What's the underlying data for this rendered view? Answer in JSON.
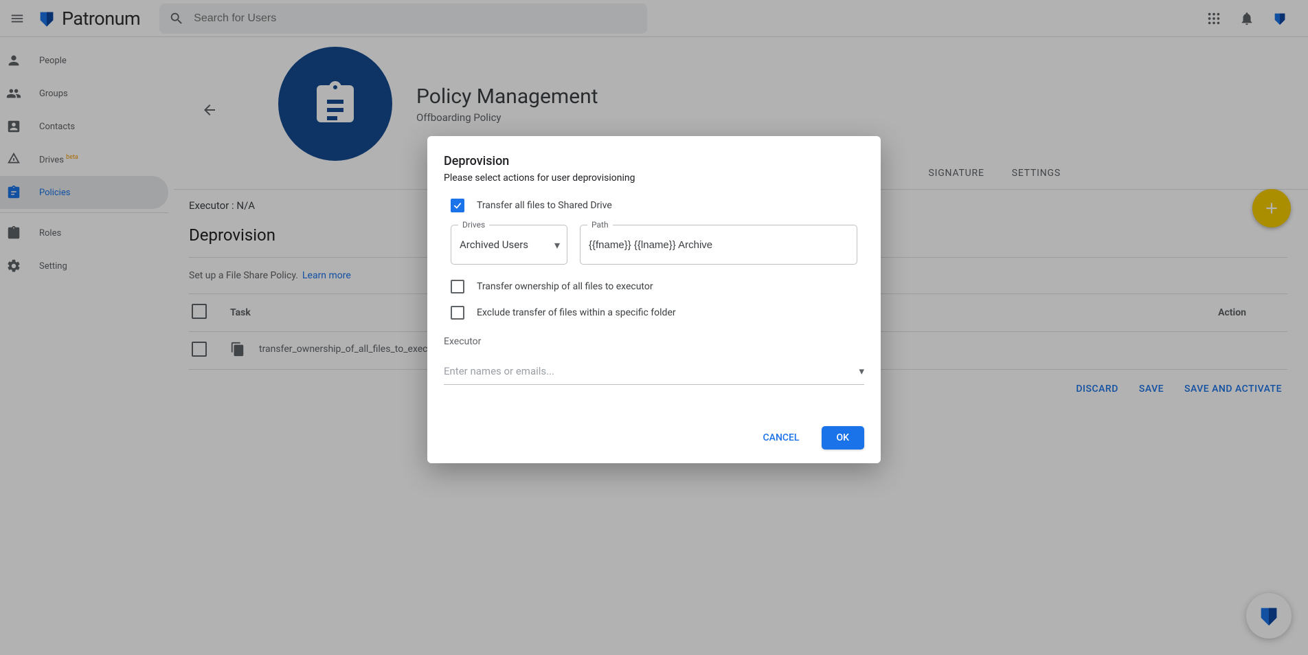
{
  "brand": {
    "name": "Patronum"
  },
  "search": {
    "placeholder": "Search for Users"
  },
  "sidebar": {
    "items": [
      {
        "label": "People"
      },
      {
        "label": "Groups"
      },
      {
        "label": "Contacts"
      },
      {
        "label": "Drives",
        "badge": "beta"
      },
      {
        "label": "Policies"
      },
      {
        "label": "Roles"
      },
      {
        "label": "Setting"
      }
    ]
  },
  "page": {
    "title": "Policy Management",
    "subtitle": "Offboarding Policy"
  },
  "tabs": {
    "signature": "SIGNATURE",
    "settings": "SETTINGS"
  },
  "executorLine": "Executor : N/A",
  "sectionTitle": "Deprovision",
  "hint": {
    "prefix": "Set up a File Share Policy. ",
    "link": "Learn more"
  },
  "table": {
    "headers": {
      "task": "Task",
      "action": "Action"
    },
    "rows": [
      {
        "name": "transfer_ownership_of_all_files_to_executor"
      }
    ]
  },
  "footerButtons": {
    "discard": "DISCARD",
    "save": "SAVE",
    "saveActivate": "SAVE AND ACTIVATE"
  },
  "modal": {
    "title": "Deprovision",
    "subtitle": "Please select actions for user deprovisioning",
    "opt_transfer_shared": "Transfer all files to Shared Drive",
    "drivesLabel": "Drives",
    "drivesValue": "Archived Users",
    "pathLabel": "Path",
    "pathValue": "{{fname}} {{lname}} Archive",
    "opt_transfer_executor": "Transfer ownership of all files to executor",
    "opt_exclude": "Exclude transfer of files within a specific folder",
    "executorLabel": "Executor",
    "executorPlaceholder": "Enter names or emails...",
    "cancel": "CANCEL",
    "ok": "OK"
  }
}
